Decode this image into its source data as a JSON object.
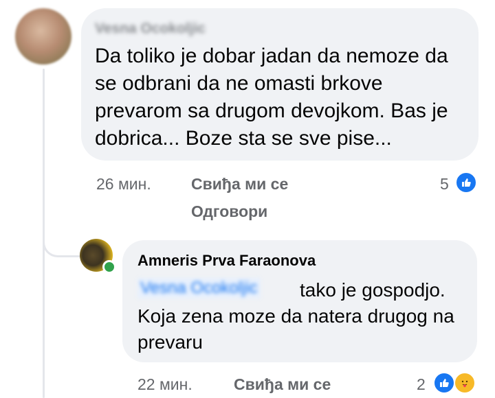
{
  "comment": {
    "author": "Vesna Ocokoljic",
    "text": "Da toliko je dobar jadan da nemoze da se odbrani da ne omasti brkove prevarom sa drugom devojkom. Bas je dobrica... Boze sta se sve pise...",
    "time": "26 мин.",
    "like_label": "Свиђа ми се",
    "reply_label": "Одговори",
    "reaction_count": "5",
    "reaction_icons": [
      "like-icon"
    ]
  },
  "reply": {
    "author": "Amneris Prva Faraonova",
    "mention": "Vesna Ocokoljic",
    "text": "tako je gospodjo. Koja zena moze da natera drugog na prevaru",
    "time": "22 мин.",
    "like_label": "Свиђа ми се",
    "reaction_count": "2",
    "reaction_icons": [
      "like-icon",
      "care-icon"
    ],
    "online": true
  },
  "colors": {
    "bubble": "#f0f2f5",
    "meta_text": "#65676b",
    "like_blue": "#1877f2",
    "online_green": "#31a24c"
  }
}
